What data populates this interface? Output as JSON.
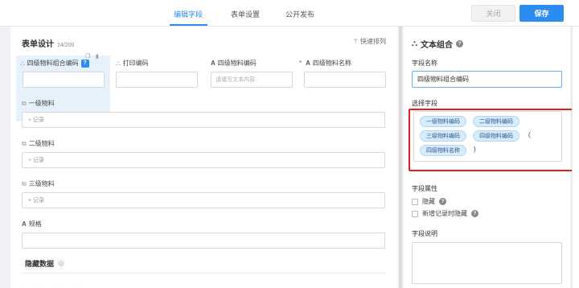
{
  "topbar": {
    "tabs": [
      "编辑字段",
      "表单设置",
      "公开发布"
    ],
    "active_tab": "编辑字段",
    "close_label": "关闭",
    "save_label": "保存"
  },
  "form": {
    "title": "表单设计",
    "count": "14/200",
    "quick_sort": "快速排列",
    "small_fields": [
      {
        "label": "四级物料组合编码",
        "value": "",
        "selected": true
      },
      {
        "label": "打印编码",
        "value": ""
      },
      {
        "label": "四级物料编码",
        "placeholder": "请填写文本内容"
      },
      {
        "label": "四级物料名称",
        "required": "*"
      }
    ],
    "sub_fields": [
      {
        "label": "一级物料",
        "add": "+ 记录"
      },
      {
        "label": "二级物料",
        "add": "+ 记录"
      },
      {
        "label": "三级物料",
        "add": "+ 记录"
      }
    ],
    "spec_label": "规格",
    "hidden_section": "隐藏数据"
  },
  "panel": {
    "title": "文本组合",
    "field_name_label": "字段名称",
    "field_name_value": "四级物料组合编码",
    "select_field_label": "选择字段",
    "chips": [
      "一级物料编码",
      "二级物料编码",
      "三级物料编码",
      "四级物料编码",
      "四级物料名称"
    ],
    "paren_open": "(",
    "paren_close": ")",
    "attr_label": "字段属性",
    "hide_label": "隐藏",
    "hide_on_new_label": "新增记录时隐藏",
    "desc_label": "字段说明"
  },
  "colors": {
    "accent": "#2d8cf0",
    "highlight_box": "#e02020",
    "chip_bg": "#d8ebfa"
  }
}
